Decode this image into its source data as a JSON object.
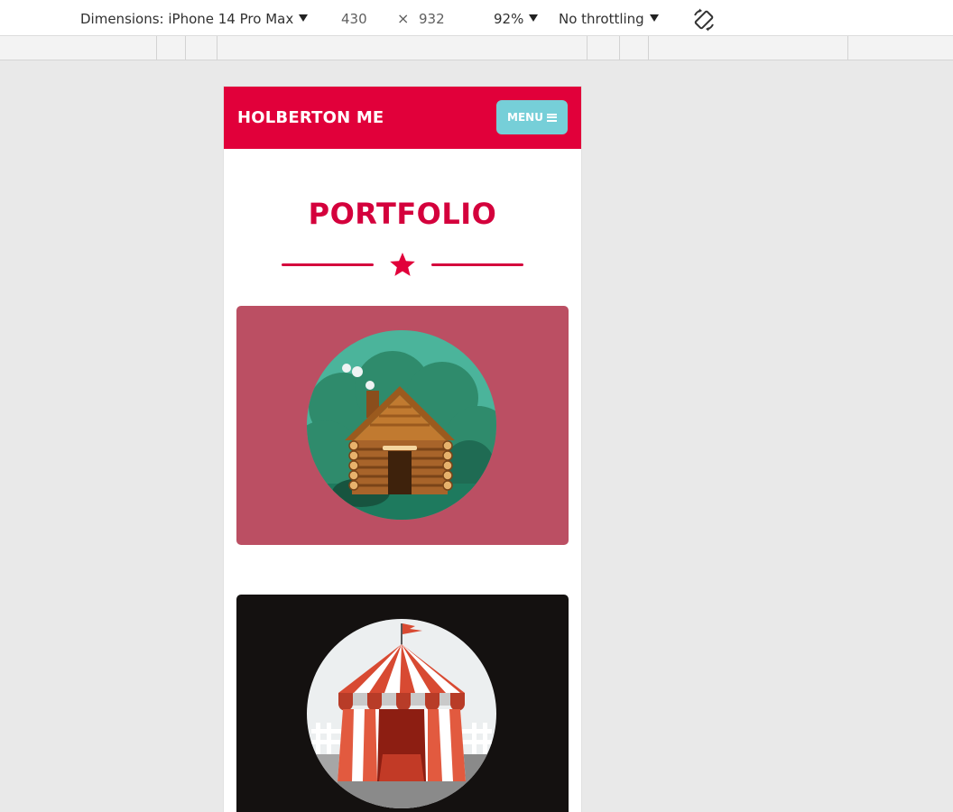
{
  "devtools": {
    "dimensions_label": "Dimensions: iPhone 14 Pro Max",
    "width": "430",
    "times": "×",
    "height": "932",
    "zoom": "92%",
    "throttling": "No throttling",
    "rotate_icon": "rotate-icon"
  },
  "page": {
    "brand": "HOLBERTON ME",
    "menu_label": "MENU",
    "menu_icon": "hamburger-icon",
    "section_title": "PORTFOLIO",
    "divider_icon": "star-icon",
    "accent_color": "#e1003a",
    "button_color": "#76cfd8",
    "portfolio": [
      {
        "image": "cabin-illustration",
        "background": "#bb4f63"
      },
      {
        "image": "circus-tent-illustration",
        "background": "#141110"
      }
    ]
  }
}
